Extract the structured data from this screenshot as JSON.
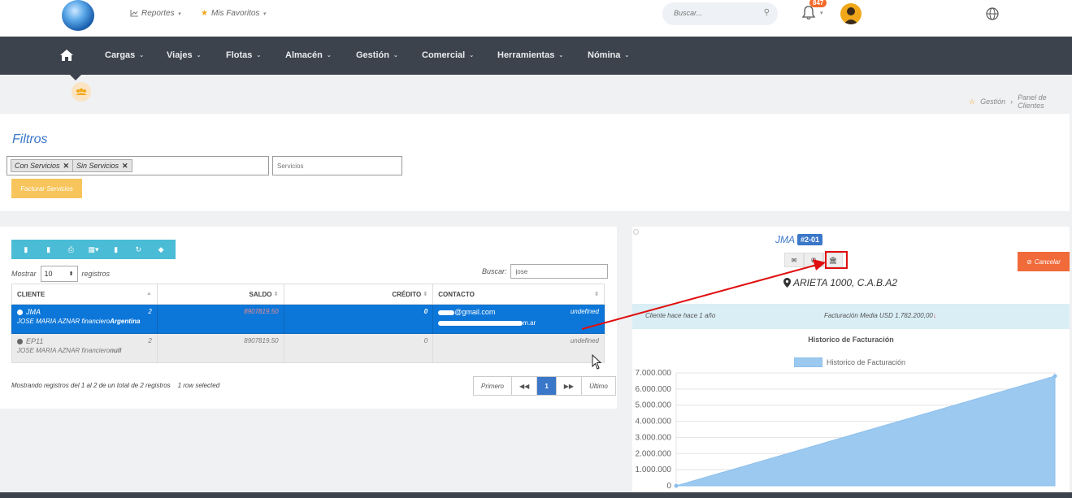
{
  "header": {
    "menus": [
      {
        "icon": "chart-icon",
        "label": "Reportes"
      },
      {
        "icon": "star-icon",
        "label": "Mis Favoritos"
      }
    ],
    "search_placeholder": "Buscar...",
    "notifications_count": "847"
  },
  "nav": {
    "items": [
      "Cargas",
      "Viajes",
      "Flotas",
      "Almacén",
      "Gestión",
      "Comercial",
      "Herramientas",
      "Nómina"
    ]
  },
  "breadcrumb": [
    "Gestión",
    "Panel de Clientes"
  ],
  "filtros": {
    "title": "Filtros",
    "tags": [
      "Con Servicios",
      "Sin Servicios"
    ],
    "servicios_placeholder": "Servicios",
    "facturar_label": "Facturar Servicios"
  },
  "table": {
    "mostrar_label": "Mostrar",
    "length_value": "10",
    "registros_label": "registros",
    "buscar_label": "Buscar:",
    "buscar_value": "jose",
    "columns": [
      "CLIENTE",
      "SALDO",
      "CRÉDITO",
      "CONTACTO"
    ],
    "rows": [
      {
        "name": "JMA",
        "sub_name": "JOSE MARIA AZNAR financiero",
        "sub_country": "Argentina",
        "count": "2",
        "saldo": "8907819.50",
        "credito": "0",
        "contact_email1": "@gmail.com",
        "contact_email2": "m.ar",
        "contact_extra": "undefined"
      },
      {
        "name": "EP11",
        "sub_name": "JOSE MARIA AZNAR financiero",
        "sub_country": "null",
        "count": "2",
        "saldo": "8907819.50",
        "credito": "0",
        "contact_extra": "undefined"
      }
    ],
    "info": "Mostrando registros del 1 al 2 de un total de 2 registros",
    "selected_info": "1 row selected",
    "pager": {
      "first": "Primero",
      "current": "1",
      "last": "Último"
    }
  },
  "detail": {
    "name": "JMA",
    "code": "#2-01",
    "cancel_label": "Cancelar",
    "address": "ARIETA 1000, C.A.B.A2",
    "since": "Cliente hace hace 1 año",
    "facturacion": "Facturación Media USD 1.782.200,00",
    "chart_title": "Historico de Facturación"
  },
  "colors": {
    "accent": "#3a77c8",
    "nav_bg": "#3d434c",
    "selected_row": "#0d77d9",
    "toolbar": "#4bbcd5",
    "facturar": "#f7c55b",
    "cancel": "#f06a3a",
    "chart_fill": "#9bc9f0",
    "annotation": "#e01010"
  },
  "chart_data": {
    "type": "area",
    "title": "Historico de Facturación",
    "series": [
      {
        "name": "Historico de Facturación",
        "x": [
          0,
          1
        ],
        "values": [
          0,
          6800000
        ]
      }
    ],
    "y_ticks": [
      "7.000.000",
      "6.000.000",
      "5.000.000",
      "4.000.000",
      "3.000.000",
      "2.000.000",
      "1.000.000",
      "0"
    ],
    "ylim": [
      0,
      7000000
    ],
    "grid": true,
    "legend": "top"
  }
}
